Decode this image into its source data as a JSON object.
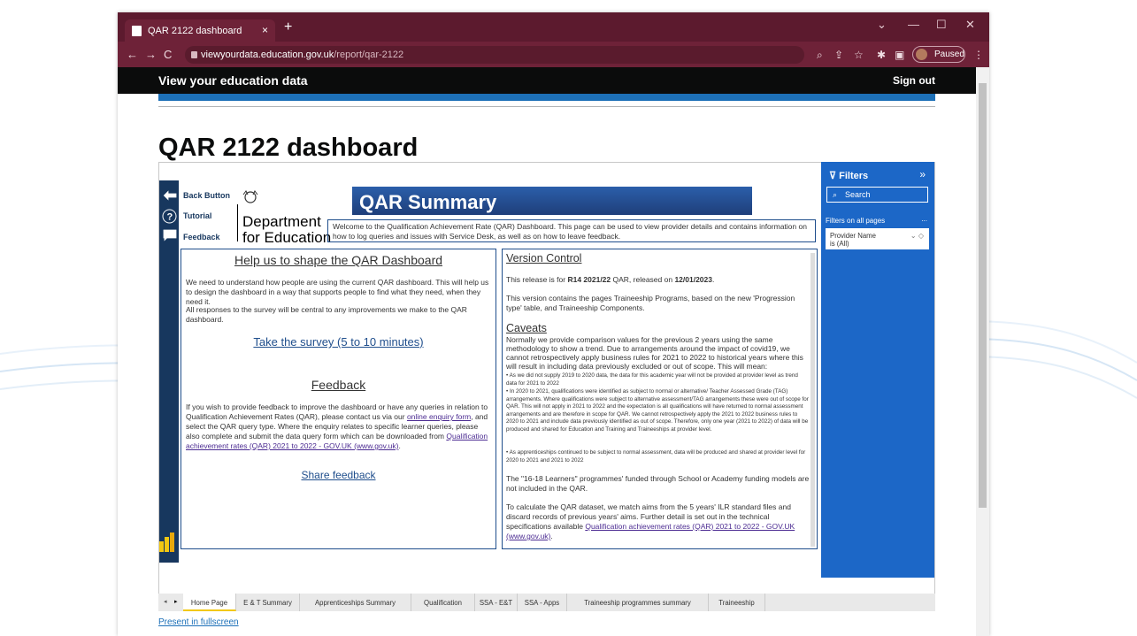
{
  "browser": {
    "tab_title": "QAR 2122 dashboard",
    "tab_close": "×",
    "new_tab": "+",
    "url_domain": "viewyourdata.education.gov.uk",
    "url_path": "/report/qar-2122",
    "profile_status": "Paused",
    "controls": {
      "minimize": "—",
      "maximize": "☐",
      "close": "✕",
      "menu": "⌄"
    }
  },
  "gov_header": {
    "brand": "View your education data",
    "sign_out": "Sign out"
  },
  "page_title": "QAR 2122 dashboard",
  "report": {
    "nav": {
      "back": "Back Button",
      "tutorial": "Tutorial",
      "feedback": "Feedback"
    },
    "logo_dept_line1": "Department",
    "logo_dept_line2": "for Education",
    "banner": "QAR Summary",
    "intro": "Welcome to the Qualification Achievement Rate (QAR) Dashboard. This page can be used to view provider details and contains information on how to log queries and issues with Service Desk, as well as on how to leave feedback.",
    "left": {
      "heading": "Help us to shape the QAR Dashboard",
      "para1": "We need to understand how people are using the current QAR dashboard. This will help us to design the dashboard in a way that supports people to find what they need, when they need it.",
      "para2": "All responses to the survey will be central to any improvements we make to the QAR dashboard.",
      "survey_link": "Take the survey (5 to 10 minutes)",
      "feedback_heading": "Feedback",
      "fb_text_a": "If you wish to provide feedback to improve the dashboard or have any queries in relation to Qualification Achievement Rates (QAR), please contact us via our ",
      "fb_link_enquiry": "online enquiry form",
      "fb_text_b": ", and select the QAR query type. Where the enquiry relates to specific learner queries, please also complete and submit the data query form which can be downloaded from ",
      "fb_link_gov": "Qualification achievement rates (QAR) 2021 to 2022 - GOV.UK (www.gov.uk)",
      "fb_text_c": ".",
      "share_link": "Share feedback"
    },
    "right": {
      "version_heading": "Version Control",
      "release_a": "This release is for ",
      "release_b": "R14 2021/22",
      "release_c": " QAR, released on ",
      "release_d": "12/01/2023",
      "release_e": ".",
      "contains": "This version contains the pages Traineeship Programs, based on the new 'Progression type' table, and Traineeship Components.",
      "caveats_heading": "Caveats",
      "caveats_text": "Normally we provide comparison values for the previous 2 years using the same methodology to show a trend. Due to arrangements around the impact of covid19, we cannot retrospectively apply business rules for 2021 to 2022 to historical years where this will result in including data previously excluded or out of scope. This will mean:",
      "bullets": [
        "• As we did not supply 2019 to 2020 data, the data for this academic year will not be provided at provider level as trend data for 2021 to 2022",
        "• In 2020 to 2021, qualifications were identified as subject to normal or alternative/ Teacher Assessed Grade (TAG) arrangements. Where qualifications were subject to alternative assessment/TAG arrangements these were out of scope for QAR. This will not apply in 2021 to 2022 and the expectation is all qualifications will have returned to normal assessment arrangements and are therefore in scope for QAR. We cannot retrospectively apply the 2021 to 2022 business rules to 2020 to 2021 and include data previously identified as out of scope. Therefore, only one year (2021 to 2022) of data will be produced and shared for Education and Training and Traineeships at provider level.",
        "• As apprenticeships continued to be subject to normal assessment, data will be produced and shared at provider level for 2020 to 2021 and 2021 to 2022"
      ],
      "learners": "The \"16-18 Learners\" programmes' funded through School or Academy funding models are not included in the QAR.",
      "calc": "To calculate the QAR dataset, we match aims from the 5 years' ILR standard files and discard records of previous years' aims. Further detail is set out in the technical specifications available",
      "calc_link": "Qualification achievement rates (QAR) 2021 to 2022 - GOV.UK (www.gov.uk)",
      "calc_end": "."
    }
  },
  "filters": {
    "title": "Filters",
    "search_placeholder": "Search",
    "on_all_pages": "Filters on all pages",
    "more": "...",
    "card_title": "Provider Name",
    "card_value": "is (All)"
  },
  "page_tabs": [
    "Home Page",
    "E & T Summary",
    "Apprenticeships Summary",
    "Qualification",
    "SSA - E&T",
    "SSA - Apps",
    "Traineeship programmes summary",
    "Traineeship"
  ],
  "present_fullscreen": "Present in fullscreen"
}
